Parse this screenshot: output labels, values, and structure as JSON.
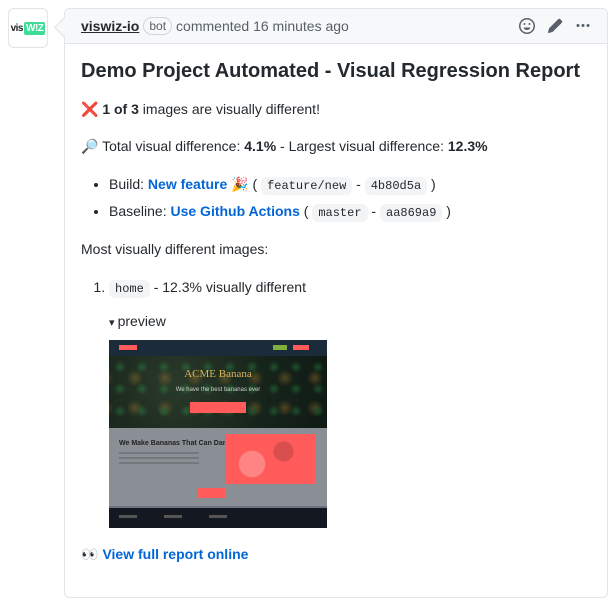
{
  "header": {
    "author": "viswiz-io",
    "bot_label": "bot",
    "action": "commented",
    "time": "16 minutes ago"
  },
  "report": {
    "title": "Demo Project Automated - Visual Regression Report",
    "summary": {
      "cross": "❌",
      "count": "1 of 3",
      "suffix": " images are visually different!"
    },
    "totals": {
      "mag": "🔎",
      "lead": " Total visual difference: ",
      "total_pct": "4.1%",
      "mid": " - Largest visual difference: ",
      "largest_pct": "12.3%"
    },
    "build": {
      "label": "Build: ",
      "link": "New feature",
      "emoji": "🎉",
      "branch": "feature/new",
      "sha": "4b80d5a"
    },
    "baseline": {
      "label": "Baseline: ",
      "link": "Use Github Actions",
      "branch": "master",
      "sha": "aa869a9"
    },
    "most_diff_heading": "Most visually different images:",
    "items": [
      {
        "name": "home",
        "diff_text": " - 12.3% visually different",
        "preview_label": "preview",
        "mock": {
          "hero_title": "ACME Banana",
          "hero_sub": "We have the best bananas ever",
          "mid_heading": "We Make Bananas That Can Dance"
        }
      }
    ],
    "footer_link": "View full report online"
  }
}
